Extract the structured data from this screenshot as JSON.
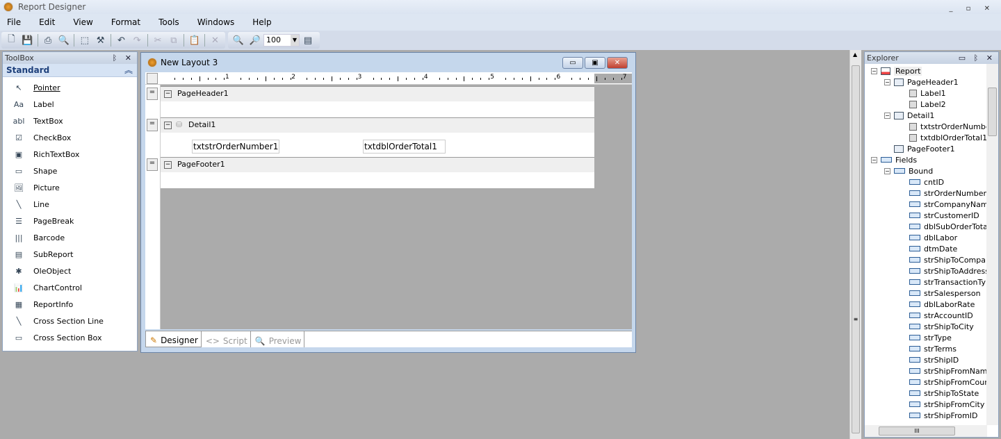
{
  "app": {
    "title": "Report Designer"
  },
  "menu": [
    "File",
    "Edit",
    "View",
    "Format",
    "Tools",
    "Windows",
    "Help"
  ],
  "toolbar": {
    "buttons": [
      "new-icon",
      "save-icon",
      "print-icon",
      "print-preview-icon",
      "grid-icon",
      "tools-icon",
      "undo-icon",
      "redo-icon",
      "cut-icon",
      "copy-icon",
      "paste-icon",
      "delete-icon",
      "zoom-out-icon",
      "zoom-in-icon",
      "page-setup-icon"
    ],
    "zoom": "100"
  },
  "toolbox": {
    "title": "ToolBox",
    "group": "Standard",
    "items": [
      {
        "label": "Pointer",
        "icon": "pointer-icon"
      },
      {
        "label": "Label",
        "icon": "label-icon"
      },
      {
        "label": "TextBox",
        "icon": "textbox-icon"
      },
      {
        "label": "CheckBox",
        "icon": "checkbox-icon"
      },
      {
        "label": "RichTextBox",
        "icon": "richtextbox-icon"
      },
      {
        "label": "Shape",
        "icon": "shape-icon"
      },
      {
        "label": "Picture",
        "icon": "picture-icon"
      },
      {
        "label": "Line",
        "icon": "line-icon"
      },
      {
        "label": "PageBreak",
        "icon": "pagebreak-icon"
      },
      {
        "label": "Barcode",
        "icon": "barcode-icon"
      },
      {
        "label": "SubReport",
        "icon": "subreport-icon"
      },
      {
        "label": "OleObject",
        "icon": "oleobject-icon"
      },
      {
        "label": "ChartControl",
        "icon": "chart-icon"
      },
      {
        "label": "ReportInfo",
        "icon": "reportinfo-icon"
      },
      {
        "label": "Cross Section Line",
        "icon": "cross-section-line-icon"
      },
      {
        "label": "Cross Section Box",
        "icon": "cross-section-box-icon"
      }
    ]
  },
  "layout": {
    "title": "New Layout 3",
    "ruler": [
      "1",
      "2",
      "3",
      "4",
      "5",
      "6",
      "7"
    ],
    "sections": [
      {
        "name": "PageHeader1"
      },
      {
        "name": "Detail1",
        "fields": [
          "txtstrOrderNumber1",
          "txtdblOrderTotal1"
        ]
      },
      {
        "name": "PageFooter1"
      }
    ],
    "tabs": [
      {
        "label": "Designer",
        "active": true,
        "icon": "pencil-icon"
      },
      {
        "label": "Script",
        "active": false,
        "icon": "code-icon"
      },
      {
        "label": "Preview",
        "active": false,
        "icon": "magnifier-icon"
      }
    ]
  },
  "explorer": {
    "title": "Explorer",
    "tree": [
      {
        "label": "Report",
        "level": 0,
        "type": "report"
      },
      {
        "label": "PageHeader1",
        "level": 1,
        "type": "section"
      },
      {
        "label": "Label1",
        "level": 2,
        "type": "control"
      },
      {
        "label": "Label2",
        "level": 2,
        "type": "control"
      },
      {
        "label": "Detail1",
        "level": 1,
        "type": "section"
      },
      {
        "label": "txtstrOrderNumber",
        "level": 2,
        "type": "control"
      },
      {
        "label": "txtdblOrderTotal1",
        "level": 2,
        "type": "control"
      },
      {
        "label": "PageFooter1",
        "level": 1,
        "type": "section"
      },
      {
        "label": "Fields",
        "level": 0,
        "type": "fields"
      },
      {
        "label": "Bound",
        "level": 1,
        "type": "fields"
      },
      {
        "label": "cntID",
        "level": 2,
        "type": "field"
      },
      {
        "label": "strOrderNumber",
        "level": 2,
        "type": "field"
      },
      {
        "label": "strCompanyName",
        "level": 2,
        "type": "field"
      },
      {
        "label": "strCustomerID",
        "level": 2,
        "type": "field"
      },
      {
        "label": "dblSubOrderTotal",
        "level": 2,
        "type": "field"
      },
      {
        "label": "dblLabor",
        "level": 2,
        "type": "field"
      },
      {
        "label": "dtmDate",
        "level": 2,
        "type": "field"
      },
      {
        "label": "strShipToCompany",
        "level": 2,
        "type": "field"
      },
      {
        "label": "strShipToAddress",
        "level": 2,
        "type": "field"
      },
      {
        "label": "strTransactionType",
        "level": 2,
        "type": "field"
      },
      {
        "label": "strSalesperson",
        "level": 2,
        "type": "field"
      },
      {
        "label": "dblLaborRate",
        "level": 2,
        "type": "field"
      },
      {
        "label": "strAccountID",
        "level": 2,
        "type": "field"
      },
      {
        "label": "strShipToCity",
        "level": 2,
        "type": "field"
      },
      {
        "label": "strType",
        "level": 2,
        "type": "field"
      },
      {
        "label": "strTerms",
        "level": 2,
        "type": "field"
      },
      {
        "label": "strShipID",
        "level": 2,
        "type": "field"
      },
      {
        "label": "strShipFromName",
        "level": 2,
        "type": "field"
      },
      {
        "label": "strShipFromCounty",
        "level": 2,
        "type": "field"
      },
      {
        "label": "strShipToState",
        "level": 2,
        "type": "field"
      },
      {
        "label": "strShipFromCity",
        "level": 2,
        "type": "field"
      },
      {
        "label": "strShipFromID",
        "level": 2,
        "type": "field"
      }
    ]
  }
}
